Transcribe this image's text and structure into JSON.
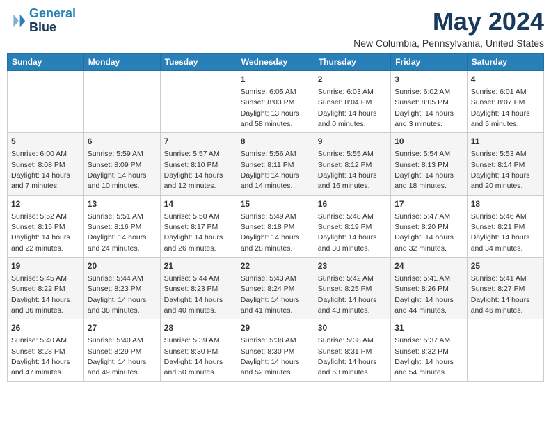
{
  "logo": {
    "line1": "General",
    "line2": "Blue"
  },
  "title": "May 2024",
  "location": "New Columbia, Pennsylvania, United States",
  "days_of_week": [
    "Sunday",
    "Monday",
    "Tuesday",
    "Wednesday",
    "Thursday",
    "Friday",
    "Saturday"
  ],
  "weeks": [
    [
      {
        "day": "",
        "content": ""
      },
      {
        "day": "",
        "content": ""
      },
      {
        "day": "",
        "content": ""
      },
      {
        "day": "1",
        "content": "Sunrise: 6:05 AM\nSunset: 8:03 PM\nDaylight: 13 hours\nand 58 minutes."
      },
      {
        "day": "2",
        "content": "Sunrise: 6:03 AM\nSunset: 8:04 PM\nDaylight: 14 hours\nand 0 minutes."
      },
      {
        "day": "3",
        "content": "Sunrise: 6:02 AM\nSunset: 8:05 PM\nDaylight: 14 hours\nand 3 minutes."
      },
      {
        "day": "4",
        "content": "Sunrise: 6:01 AM\nSunset: 8:07 PM\nDaylight: 14 hours\nand 5 minutes."
      }
    ],
    [
      {
        "day": "5",
        "content": "Sunrise: 6:00 AM\nSunset: 8:08 PM\nDaylight: 14 hours\nand 7 minutes."
      },
      {
        "day": "6",
        "content": "Sunrise: 5:59 AM\nSunset: 8:09 PM\nDaylight: 14 hours\nand 10 minutes."
      },
      {
        "day": "7",
        "content": "Sunrise: 5:57 AM\nSunset: 8:10 PM\nDaylight: 14 hours\nand 12 minutes."
      },
      {
        "day": "8",
        "content": "Sunrise: 5:56 AM\nSunset: 8:11 PM\nDaylight: 14 hours\nand 14 minutes."
      },
      {
        "day": "9",
        "content": "Sunrise: 5:55 AM\nSunset: 8:12 PM\nDaylight: 14 hours\nand 16 minutes."
      },
      {
        "day": "10",
        "content": "Sunrise: 5:54 AM\nSunset: 8:13 PM\nDaylight: 14 hours\nand 18 minutes."
      },
      {
        "day": "11",
        "content": "Sunrise: 5:53 AM\nSunset: 8:14 PM\nDaylight: 14 hours\nand 20 minutes."
      }
    ],
    [
      {
        "day": "12",
        "content": "Sunrise: 5:52 AM\nSunset: 8:15 PM\nDaylight: 14 hours\nand 22 minutes."
      },
      {
        "day": "13",
        "content": "Sunrise: 5:51 AM\nSunset: 8:16 PM\nDaylight: 14 hours\nand 24 minutes."
      },
      {
        "day": "14",
        "content": "Sunrise: 5:50 AM\nSunset: 8:17 PM\nDaylight: 14 hours\nand 26 minutes."
      },
      {
        "day": "15",
        "content": "Sunrise: 5:49 AM\nSunset: 8:18 PM\nDaylight: 14 hours\nand 28 minutes."
      },
      {
        "day": "16",
        "content": "Sunrise: 5:48 AM\nSunset: 8:19 PM\nDaylight: 14 hours\nand 30 minutes."
      },
      {
        "day": "17",
        "content": "Sunrise: 5:47 AM\nSunset: 8:20 PM\nDaylight: 14 hours\nand 32 minutes."
      },
      {
        "day": "18",
        "content": "Sunrise: 5:46 AM\nSunset: 8:21 PM\nDaylight: 14 hours\nand 34 minutes."
      }
    ],
    [
      {
        "day": "19",
        "content": "Sunrise: 5:45 AM\nSunset: 8:22 PM\nDaylight: 14 hours\nand 36 minutes."
      },
      {
        "day": "20",
        "content": "Sunrise: 5:44 AM\nSunset: 8:23 PM\nDaylight: 14 hours\nand 38 minutes."
      },
      {
        "day": "21",
        "content": "Sunrise: 5:44 AM\nSunset: 8:23 PM\nDaylight: 14 hours\nand 40 minutes."
      },
      {
        "day": "22",
        "content": "Sunrise: 5:43 AM\nSunset: 8:24 PM\nDaylight: 14 hours\nand 41 minutes."
      },
      {
        "day": "23",
        "content": "Sunrise: 5:42 AM\nSunset: 8:25 PM\nDaylight: 14 hours\nand 43 minutes."
      },
      {
        "day": "24",
        "content": "Sunrise: 5:41 AM\nSunset: 8:26 PM\nDaylight: 14 hours\nand 44 minutes."
      },
      {
        "day": "25",
        "content": "Sunrise: 5:41 AM\nSunset: 8:27 PM\nDaylight: 14 hours\nand 46 minutes."
      }
    ],
    [
      {
        "day": "26",
        "content": "Sunrise: 5:40 AM\nSunset: 8:28 PM\nDaylight: 14 hours\nand 47 minutes."
      },
      {
        "day": "27",
        "content": "Sunrise: 5:40 AM\nSunset: 8:29 PM\nDaylight: 14 hours\nand 49 minutes."
      },
      {
        "day": "28",
        "content": "Sunrise: 5:39 AM\nSunset: 8:30 PM\nDaylight: 14 hours\nand 50 minutes."
      },
      {
        "day": "29",
        "content": "Sunrise: 5:38 AM\nSunset: 8:30 PM\nDaylight: 14 hours\nand 52 minutes."
      },
      {
        "day": "30",
        "content": "Sunrise: 5:38 AM\nSunset: 8:31 PM\nDaylight: 14 hours\nand 53 minutes."
      },
      {
        "day": "31",
        "content": "Sunrise: 5:37 AM\nSunset: 8:32 PM\nDaylight: 14 hours\nand 54 minutes."
      },
      {
        "day": "",
        "content": ""
      }
    ]
  ]
}
